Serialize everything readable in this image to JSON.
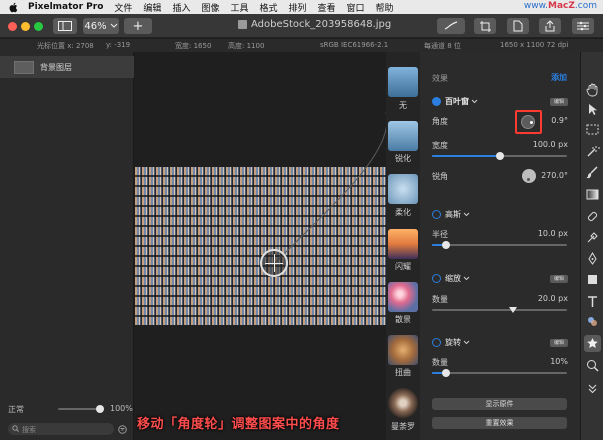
{
  "menubar": {
    "app_name": "Pixelmator Pro",
    "items": [
      "文件",
      "编辑",
      "插入",
      "图像",
      "工具",
      "格式",
      "排列",
      "查看",
      "窗口",
      "帮助"
    ],
    "watermark_prefix": "www.",
    "watermark_brand": "MacZ",
    "watermark_suffix": ".com"
  },
  "toolbar": {
    "zoom": "46%",
    "add_label": "+",
    "document_title": "AdobeStock_203958648.jpg"
  },
  "infobar": {
    "cursor_x": "光标位置 x: 2708",
    "cursor_y": "y: -319",
    "width": "宽度: 1650",
    "height": "高度: 1100",
    "color_profile": "sRGB IEC61966-2.1",
    "bit_depth": "每通道 8 位",
    "dimensions": "1650 x 1100 72 dpi"
  },
  "layers": {
    "layer_name": "背景图层",
    "blend_mode": "正常",
    "opacity": "100%",
    "search_placeholder": "搜索"
  },
  "canvas": {
    "caption": "移动「角度轮」调整图案中的角度"
  },
  "effects_browser": {
    "items": [
      "无",
      "锐化",
      "柔化",
      "闪耀",
      "散景",
      "扭曲",
      "曼荼罗"
    ]
  },
  "effects_panel": {
    "title": "效果",
    "add_label": "添加",
    "edit_label": "编辑",
    "blinds": {
      "name": "百叶窗",
      "angle_label": "角度",
      "angle_value": "0.9°",
      "width_label": "宽度",
      "width_value": "100.0 px",
      "sharp_label": "锐角",
      "sharp_value": "270.0°",
      "width_fraction": 0.5
    },
    "gaussian": {
      "name": "高斯",
      "radius_label": "半径",
      "radius_value": "10.0 px",
      "radius_fraction": 0.1
    },
    "zoom": {
      "name": "缩放",
      "amount_label": "数量",
      "amount_value": "20.0 px",
      "amount_fraction": 0.6
    },
    "spin": {
      "name": "旋转",
      "amount_label": "数量",
      "amount_value": "10%",
      "amount_fraction": 0.1
    },
    "show_original": "显示原件",
    "reset_effects": "重置效果"
  },
  "colors": {
    "accent": "#2a7fe0",
    "highlight": "#ff3b30",
    "caption": "#ff4d4d"
  }
}
